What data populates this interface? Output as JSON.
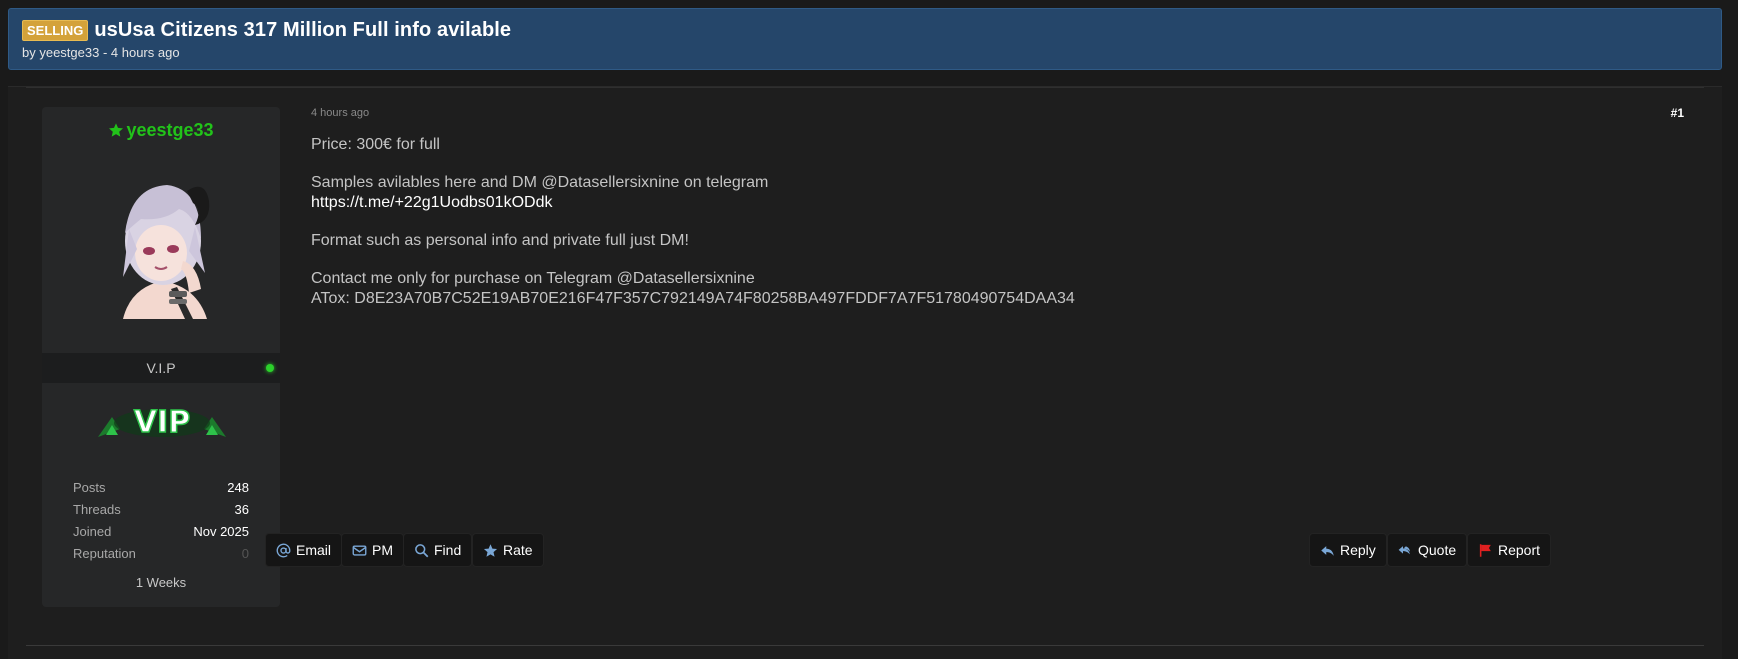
{
  "thread": {
    "prefix": "SELLING",
    "title": "usUsa Citizens 317 Million Full info avilable",
    "byline": "by yeestge33 - 4 hours ago"
  },
  "user": {
    "username": "yeestge33",
    "rank_title": "V.I.P",
    "rank_image_text": "VIP",
    "stats": [
      {
        "label": "Posts",
        "value": "248"
      },
      {
        "label": "Threads",
        "value": "36"
      },
      {
        "label": "Joined",
        "value": "Nov 2025"
      },
      {
        "label": "Reputation",
        "value": "0"
      }
    ],
    "membership": "1 Weeks",
    "username_color": "#22c21a",
    "online_color": "#2bd12b"
  },
  "post": {
    "date": "4 hours ago",
    "number": "#1",
    "line_price": "Price: 300€ for full",
    "line_samples": "Samples avilables here and DM @Datasellersixnine on telegram",
    "link": "https://t.me/+22g1Uodbs01kODdk",
    "line_format": "Format such as personal info and private full just DM!",
    "line_contact": "Contact me only for purchase on Telegram @Datasellersixnine",
    "line_atox": "ATox: D8E23A70B7C52E19AB70E216F47F357C792149A74F80258BA497FDDF7A7F51780490754DAA34"
  },
  "buttons": {
    "email": "Email",
    "pm": "PM",
    "find": "Find",
    "rate": "Rate",
    "reply": "Reply",
    "quote": "Quote",
    "report": "Report"
  },
  "icons": {
    "email": "at-icon",
    "pm": "envelope-icon",
    "find": "search-icon",
    "rate": "star-icon",
    "reply": "reply-icon",
    "quote": "quote-icon",
    "report": "flag-icon"
  },
  "colors": {
    "header_bg": "#25466a",
    "prefix_badge": "#d4a23a",
    "report_flag": "#e02020",
    "icon_blue": "#7aa7d6"
  }
}
